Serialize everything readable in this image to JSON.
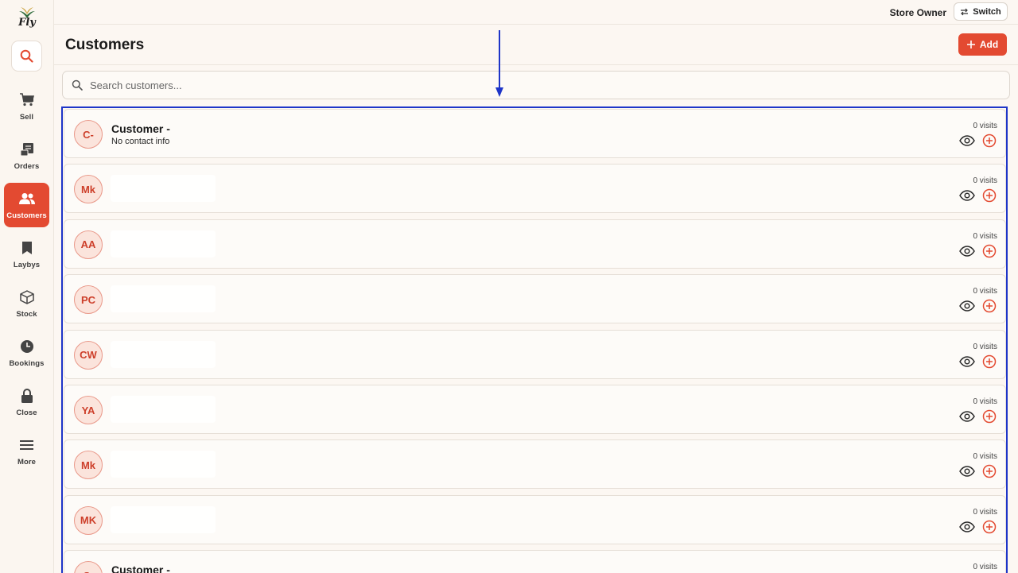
{
  "app": {
    "logo_text": "Fly"
  },
  "sidebar": {
    "items": [
      {
        "label": "Sell",
        "icon": "cart-icon"
      },
      {
        "label": "Orders",
        "icon": "receipt-icon"
      },
      {
        "label": "Customers",
        "icon": "users-icon",
        "active": true
      },
      {
        "label": "Laybys",
        "icon": "bookmark-icon"
      },
      {
        "label": "Stock",
        "icon": "box-icon"
      },
      {
        "label": "Bookings",
        "icon": "clock-icon"
      },
      {
        "label": "Close",
        "icon": "lock-icon"
      },
      {
        "label": "More",
        "icon": "menu-icon"
      }
    ]
  },
  "topbar": {
    "role": "Store Owner",
    "switch_label": "Switch"
  },
  "header": {
    "title": "Customers",
    "add_label": "Add"
  },
  "search": {
    "placeholder": "Search customers..."
  },
  "customers": [
    {
      "initials": "C-",
      "name": "Customer -",
      "contact": "No contact info",
      "visits": "0 visits"
    },
    {
      "initials": "Mk",
      "name": "",
      "contact": "",
      "visits": "0 visits"
    },
    {
      "initials": "AA",
      "name": "",
      "contact": "",
      "visits": "0 visits"
    },
    {
      "initials": "PC",
      "name": "",
      "contact": "",
      "visits": "0 visits"
    },
    {
      "initials": "CW",
      "name": "",
      "contact": "",
      "visits": "0 visits"
    },
    {
      "initials": "YA",
      "name": "",
      "contact": "",
      "visits": "0 visits"
    },
    {
      "initials": "Mk",
      "name": "",
      "contact": "",
      "visits": "0 visits"
    },
    {
      "initials": "MK",
      "name": "",
      "contact": "",
      "visits": "0 visits"
    },
    {
      "initials": "C-",
      "name": "Customer -",
      "contact": "",
      "visits": "0 visits"
    }
  ],
  "colors": {
    "accent": "#e34a31",
    "annotation": "#1e35c8",
    "background": "#fcf7f2"
  }
}
